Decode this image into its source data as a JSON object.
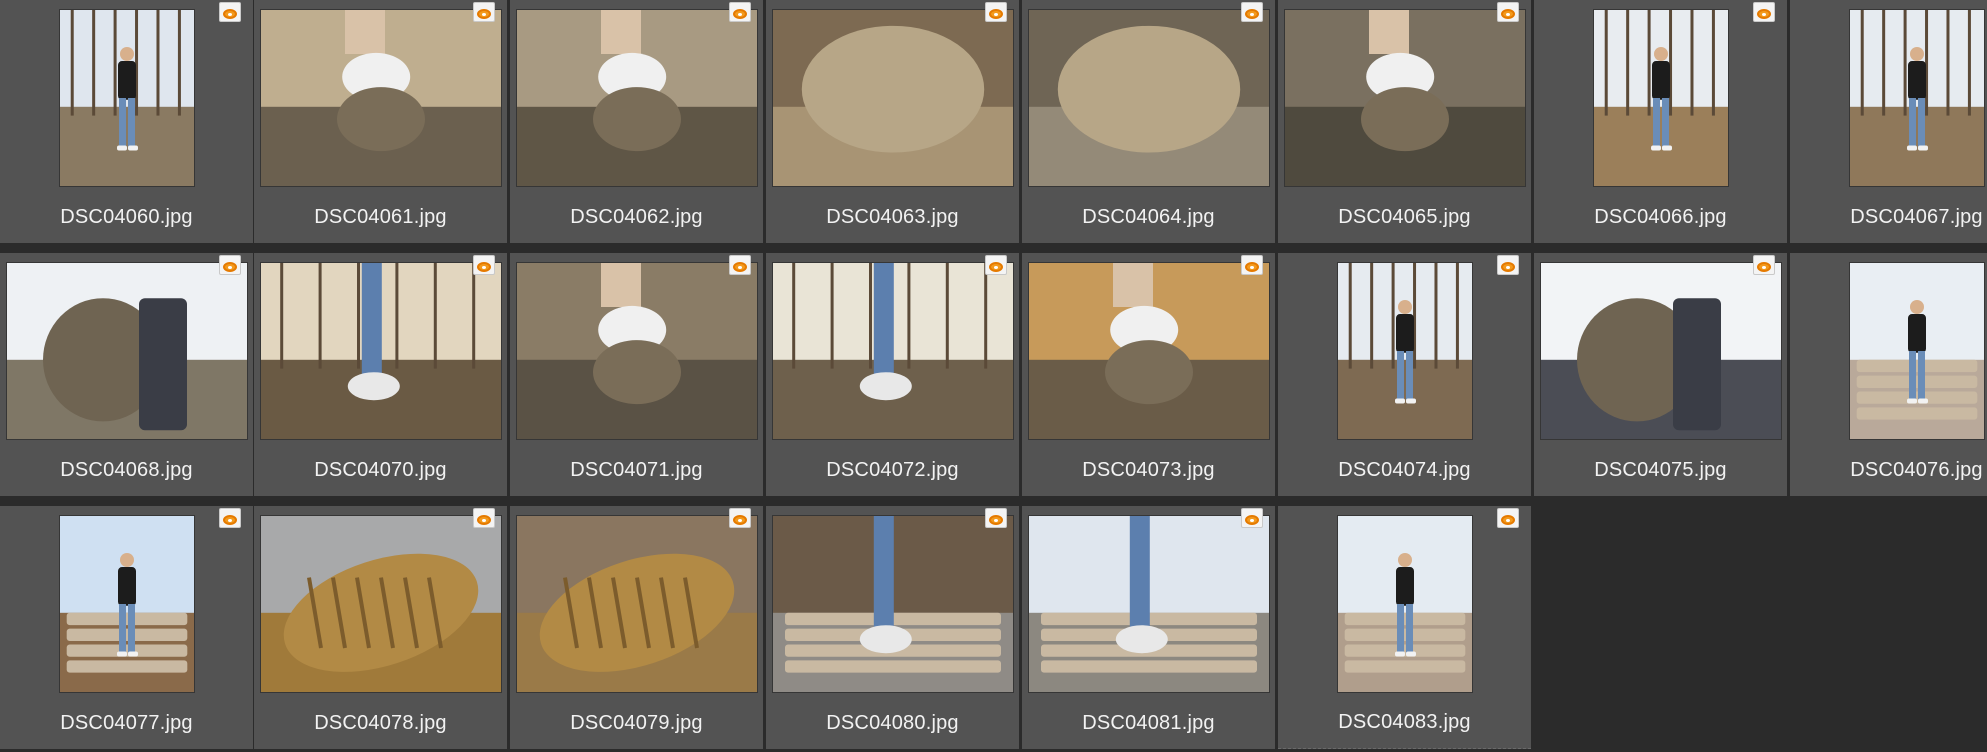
{
  "thumbnails": [
    {
      "name": "DSC04060.jpg",
      "orient": "port",
      "scene": "woods-person",
      "sky": "#dfe6ee",
      "ground": "#8a7a62"
    },
    {
      "name": "DSC04061.jpg",
      "orient": "land",
      "scene": "shoe-mud",
      "sky": "#bfae8f",
      "ground": "#6b604f"
    },
    {
      "name": "DSC04062.jpg",
      "orient": "land",
      "scene": "shoe-mud",
      "sky": "#a89a82",
      "ground": "#5f5646"
    },
    {
      "name": "DSC04063.jpg",
      "orient": "land",
      "scene": "mud-closeup",
      "sky": "#7d6a52",
      "ground": "#a89474"
    },
    {
      "name": "DSC04064.jpg",
      "orient": "land",
      "scene": "mud-closeup",
      "sky": "#6f6555",
      "ground": "#948a78"
    },
    {
      "name": "DSC04065.jpg",
      "orient": "land",
      "scene": "shoe-mud",
      "sky": "#7a7060",
      "ground": "#4f4a3e"
    },
    {
      "name": "DSC04066.jpg",
      "orient": "port",
      "scene": "woods-person",
      "sky": "#e8ecf0",
      "ground": "#9b7f5a"
    },
    {
      "name": "DSC04067.jpg",
      "orient": "port",
      "scene": "woods-person",
      "sky": "#e6ebf0",
      "ground": "#8f785a"
    },
    {
      "name": "DSC04068.jpg",
      "orient": "land",
      "scene": "cloth-mud",
      "sky": "#eef1f4",
      "ground": "#7f7766"
    },
    {
      "name": "DSC04070.jpg",
      "orient": "land",
      "scene": "woods-legs",
      "sky": "#e2d6bf",
      "ground": "#6a5a44"
    },
    {
      "name": "DSC04071.jpg",
      "orient": "land",
      "scene": "shoe-mud",
      "sky": "#8a7c66",
      "ground": "#5a5245"
    },
    {
      "name": "DSC04072.jpg",
      "orient": "land",
      "scene": "woods-legs",
      "sky": "#e9e4d6",
      "ground": "#6e604c"
    },
    {
      "name": "DSC04073.jpg",
      "orient": "land",
      "scene": "shoe-mud",
      "sky": "#c79a5a",
      "ground": "#6a5c48"
    },
    {
      "name": "DSC04074.jpg",
      "orient": "port",
      "scene": "woods-person",
      "sky": "#e6ebf0",
      "ground": "#7e6a52"
    },
    {
      "name": "DSC04075.jpg",
      "orient": "land",
      "scene": "cloth-mud",
      "sky": "#f2f4f6",
      "ground": "#4b4d55"
    },
    {
      "name": "DSC04076.jpg",
      "orient": "port",
      "scene": "logs-person",
      "sky": "#e9eef3",
      "ground": "#b9a99a"
    },
    {
      "name": "DSC04077.jpg",
      "orient": "port",
      "scene": "logs-person",
      "sky": "#cfe0f2",
      "ground": "#8a6a4a"
    },
    {
      "name": "DSC04078.jpg",
      "orient": "land",
      "scene": "sole-mud",
      "sky": "#a8a9aa",
      "ground": "#a07a3a"
    },
    {
      "name": "DSC04079.jpg",
      "orient": "land",
      "scene": "sole-mud",
      "sky": "#8a7660",
      "ground": "#9a7a48"
    },
    {
      "name": "DSC04080.jpg",
      "orient": "land",
      "scene": "logs-legs",
      "sky": "#6b5a48",
      "ground": "#8f8b86"
    },
    {
      "name": "DSC04081.jpg",
      "orient": "land",
      "scene": "logs-legs",
      "sky": "#dfe6ee",
      "ground": "#8c8880"
    },
    {
      "name": "DSC04083.jpg",
      "orient": "port",
      "scene": "logs-person",
      "sky": "#e4ebf2",
      "ground": "#b09e8c"
    }
  ]
}
